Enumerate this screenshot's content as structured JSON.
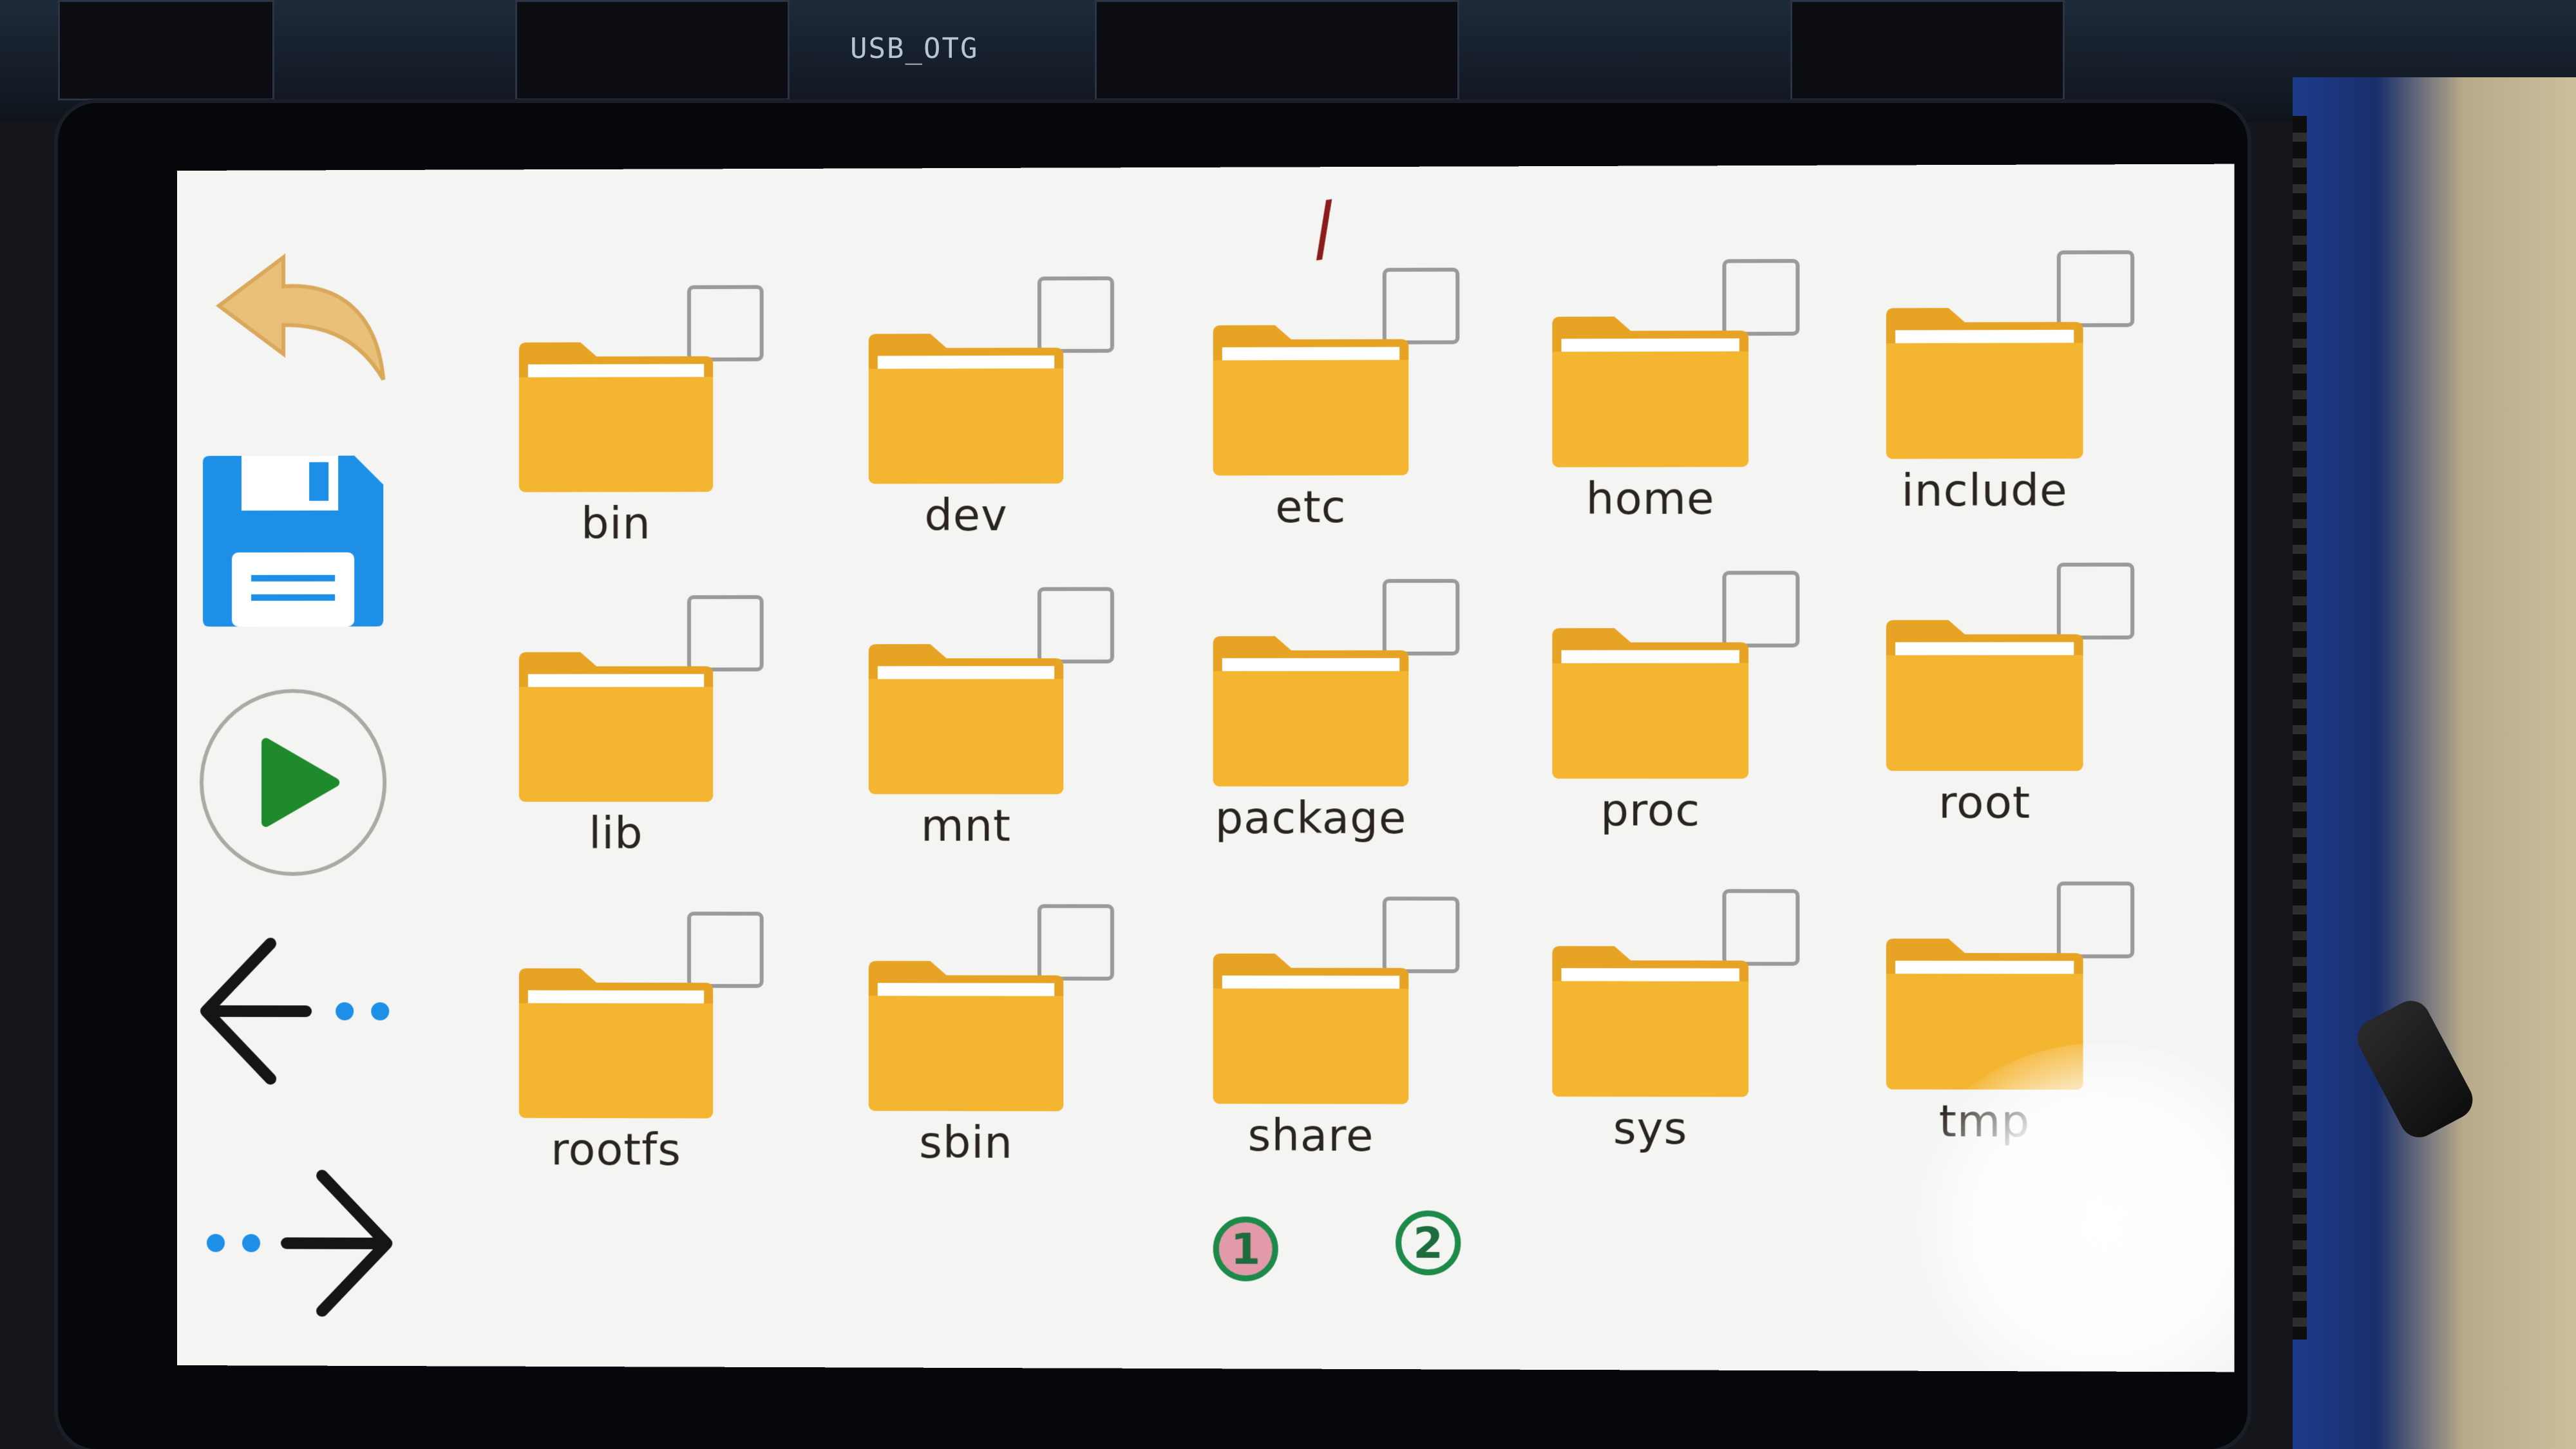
{
  "board": {
    "usb_label": "USB_OTG"
  },
  "screen": {
    "path": "/",
    "accent_folder": "#f4b531",
    "accent_folder_tab": "#e7a323",
    "accent_save": "#1d8fe6",
    "accent_play": "#1f8a2c",
    "accent_back": "#e9c079"
  },
  "sidebar": {
    "back_icon": "back-curved-arrow-icon",
    "save_icon": "floppy-disk-icon",
    "play_icon": "play-icon",
    "prev_icon": "arrow-left-icon",
    "next_icon": "arrow-right-icon"
  },
  "folders": [
    {
      "label": "bin"
    },
    {
      "label": "dev"
    },
    {
      "label": "etc"
    },
    {
      "label": "home"
    },
    {
      "label": "include"
    },
    {
      "label": "lib"
    },
    {
      "label": "mnt"
    },
    {
      "label": "package"
    },
    {
      "label": "proc"
    },
    {
      "label": "root"
    },
    {
      "label": "rootfs"
    },
    {
      "label": "sbin"
    },
    {
      "label": "share"
    },
    {
      "label": "sys"
    },
    {
      "label": "tmp"
    }
  ],
  "pagination": {
    "pages": [
      "1",
      "2"
    ],
    "current": "1"
  }
}
